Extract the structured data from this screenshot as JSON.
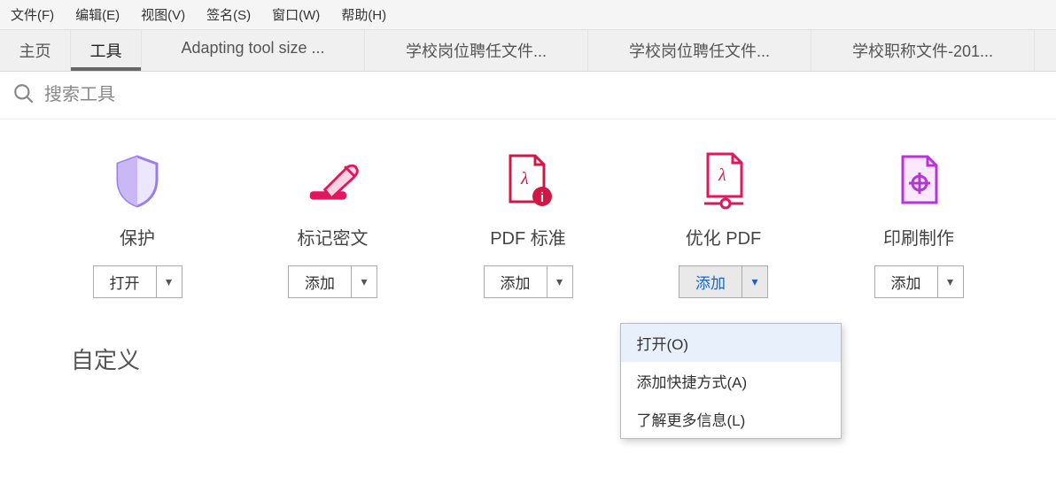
{
  "menubar": {
    "items": [
      "文件(F)",
      "编辑(E)",
      "视图(V)",
      "签名(S)",
      "窗口(W)",
      "帮助(H)"
    ]
  },
  "tabbar": {
    "home": "主页",
    "tools": "工具",
    "docs": [
      "Adapting tool size ...",
      "学校岗位聘任文件...",
      "学校岗位聘任文件...",
      "学校职称文件-201..."
    ],
    "active": "工具"
  },
  "search": {
    "placeholder": "搜索工具"
  },
  "tools": [
    {
      "id": "protect",
      "label": "保护",
      "button": "打开",
      "icon": "shield",
      "dropdown_open": false
    },
    {
      "id": "redact",
      "label": "标记密文",
      "button": "添加",
      "icon": "redact",
      "dropdown_open": false
    },
    {
      "id": "pdfstd",
      "label": "PDF 标准",
      "button": "添加",
      "icon": "pdf-info",
      "dropdown_open": false
    },
    {
      "id": "optimize",
      "label": "优化 PDF",
      "button": "添加",
      "icon": "pdf-opt",
      "dropdown_open": true
    },
    {
      "id": "print",
      "label": "印刷制作",
      "button": "添加",
      "icon": "print",
      "dropdown_open": false
    }
  ],
  "dropdown": {
    "items": [
      "打开(O)",
      "添加快捷方式(A)",
      "了解更多信息(L)"
    ],
    "hover_index": 0
  },
  "section": {
    "custom_heading": "自定义"
  },
  "colors": {
    "shield": "#9b7fe6",
    "redact": "#e1165d",
    "pdfstd": "#d01847",
    "optimize": "#e1165d",
    "print": "#b734d6"
  }
}
